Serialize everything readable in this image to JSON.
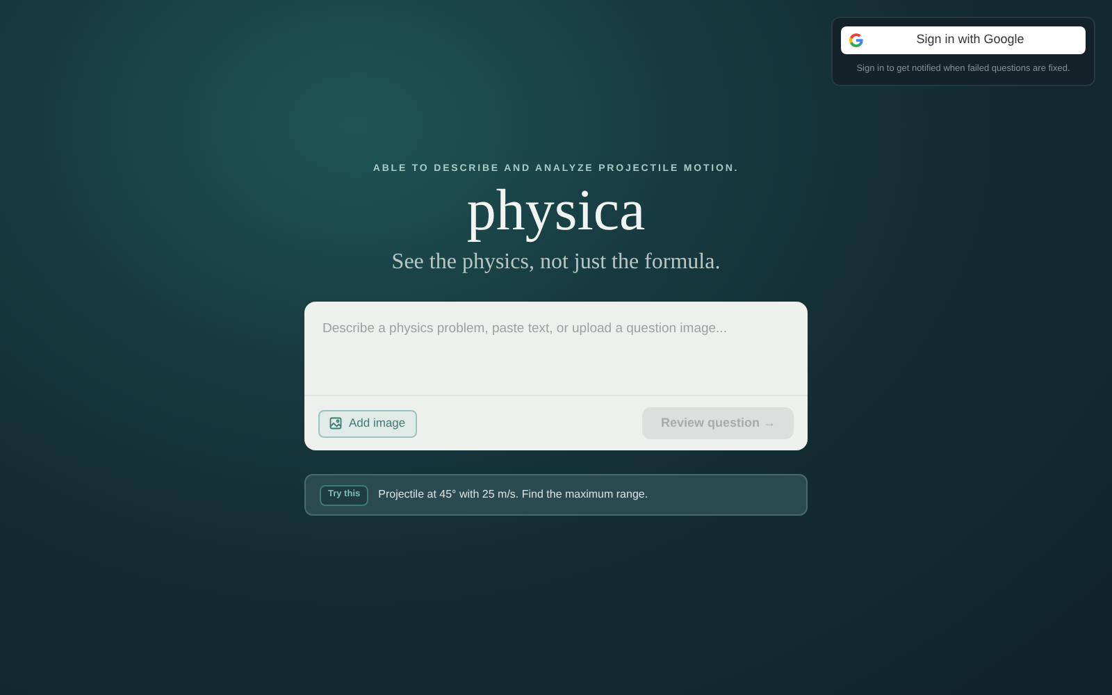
{
  "signin": {
    "button": "Sign in with Google",
    "note": "Sign in to get notified when failed questions are fixed."
  },
  "hero": {
    "eyebrow": "ABLE TO DESCRIBE AND ANALYZE PROJECTILE MOTION.",
    "title": "physica",
    "tagline": "See the physics, not just the formula."
  },
  "composer": {
    "placeholder": "Describe a physics problem, paste text, or upload a question image...",
    "add_image": "Add image",
    "submit": {
      "label": "Review question →",
      "disabled": true
    }
  },
  "suggestion": {
    "badge": "Try this",
    "text": "Projectile at 45° with 25 m/s. Find the maximum range."
  }
}
